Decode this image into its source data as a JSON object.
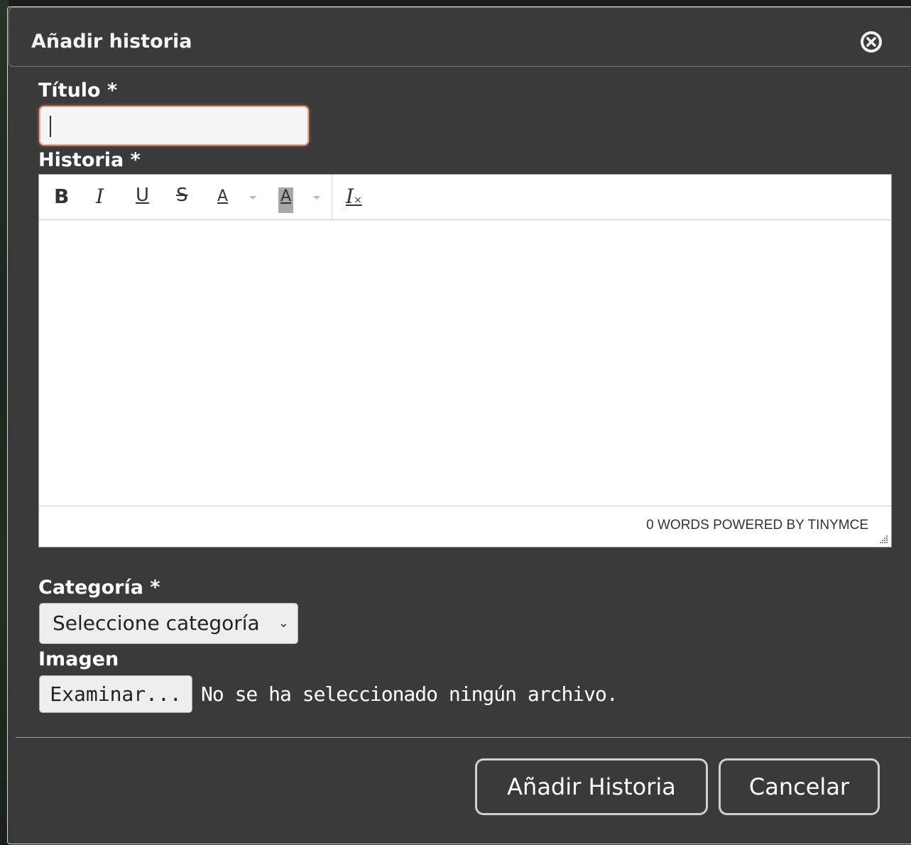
{
  "dialog": {
    "title": "Añadir historia",
    "close_icon": "close-circle-icon"
  },
  "form": {
    "titulo_label": "Título *",
    "titulo_value": "",
    "historia_label": "Historia *",
    "categoria_label": "Categoría *",
    "categoria_selected": "Seleccione categoría",
    "imagen_label": "Imagen",
    "browse_label": "Examinar...",
    "no_file_text": "No se ha seleccionado ningún archivo."
  },
  "editor": {
    "toolbar": {
      "bold": "B",
      "italic": "I",
      "underline": "U",
      "strikethrough": "S",
      "text_color": "A",
      "bg_color": "A",
      "clear_format": "I"
    },
    "status": "0 WORDS POWERED BY TINYMCE"
  },
  "actions": {
    "submit_label": "Añadir Historia",
    "cancel_label": "Cancelar"
  },
  "colors": {
    "dialog_bg": "#3a3a3a",
    "focus_border": "#e8a898"
  }
}
